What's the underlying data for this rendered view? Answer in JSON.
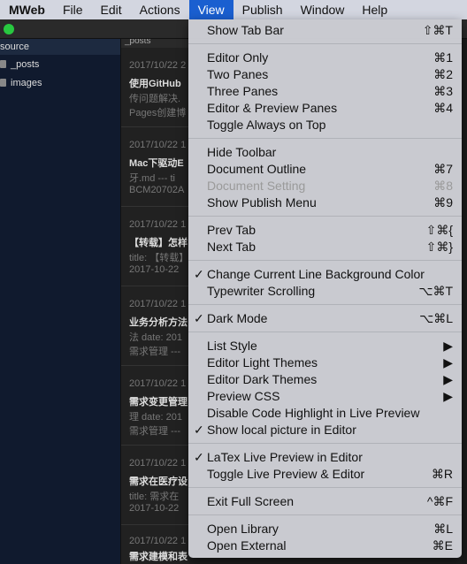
{
  "menubar": {
    "app": "MWeb",
    "items": [
      "File",
      "Edit",
      "Actions",
      "View",
      "Publish",
      "Window",
      "Help"
    ]
  },
  "sidebar": {
    "header": "source",
    "folders": [
      "_posts",
      "images"
    ]
  },
  "list": {
    "header": "_posts",
    "items": [
      {
        "date": "2017/10/22 2",
        "title": "使用GitHub",
        "line2": "传问题解决.",
        "line3": "Pages创建博"
      },
      {
        "date": "2017/10/22 1",
        "title": "Mac下驱动E",
        "line2": "牙.md --- ti",
        "line3": "BCM20702A"
      },
      {
        "date": "2017/10/22 1",
        "title": "【转载】怎样",
        "line2": "title: 【转载】",
        "line3": "2017-10-22"
      },
      {
        "date": "2017/10/22 1",
        "title": "业务分析方法",
        "line2": "法 date: 201",
        "line3": "需求管理 ---"
      },
      {
        "date": "2017/10/22 1",
        "title": "需求变更管理",
        "line2": "理 date: 201",
        "line3": "需求管理 ---"
      },
      {
        "date": "2017/10/22 1",
        "title": "需求在医疗设",
        "line2": "title: 需求在",
        "line3": "2017-10-22"
      },
      {
        "date": "2017/10/22 1",
        "title": "需求建模和表",
        "line2": "",
        "line3": ""
      }
    ]
  },
  "menu": {
    "groups": [
      [
        {
          "label": "Show Tab Bar",
          "shortcut": "⇧⌘T"
        }
      ],
      [
        {
          "label": "Editor Only",
          "shortcut": "⌘1"
        },
        {
          "label": "Two Panes",
          "shortcut": "⌘2"
        },
        {
          "label": "Three Panes",
          "shortcut": "⌘3"
        },
        {
          "label": "Editor & Preview Panes",
          "shortcut": "⌘4"
        },
        {
          "label": "Toggle Always on Top",
          "shortcut": ""
        }
      ],
      [
        {
          "label": "Hide Toolbar",
          "shortcut": ""
        },
        {
          "label": "Document Outline",
          "shortcut": "⌘7"
        },
        {
          "label": "Document Setting",
          "shortcut": "⌘8",
          "disabled": true
        },
        {
          "label": "Show Publish Menu",
          "shortcut": "⌘9"
        }
      ],
      [
        {
          "label": "Prev Tab",
          "shortcut": "⇧⌘{"
        },
        {
          "label": "Next Tab",
          "shortcut": "⇧⌘}"
        }
      ],
      [
        {
          "label": "Change Current Line Background Color",
          "shortcut": "",
          "checked": true
        },
        {
          "label": "Typewriter Scrolling",
          "shortcut": "⌥⌘T"
        }
      ],
      [
        {
          "label": "Dark Mode",
          "shortcut": "⌥⌘L",
          "checked": true
        }
      ],
      [
        {
          "label": "List Style",
          "shortcut": "▶"
        },
        {
          "label": "Editor Light Themes",
          "shortcut": "▶"
        },
        {
          "label": "Editor Dark Themes",
          "shortcut": "▶"
        },
        {
          "label": "Preview CSS",
          "shortcut": "▶"
        },
        {
          "label": "Disable Code Highlight in Live Preview",
          "shortcut": ""
        },
        {
          "label": "Show local picture in Editor",
          "shortcut": "",
          "checked": true
        }
      ],
      [
        {
          "label": "LaTex Live Preview in Editor",
          "shortcut": "",
          "checked": true
        },
        {
          "label": "Toggle Live Preview & Editor",
          "shortcut": "⌘R"
        }
      ],
      [
        {
          "label": "Exit Full Screen",
          "shortcut": "^⌘F"
        }
      ],
      [
        {
          "label": "Open Library",
          "shortcut": "⌘L"
        },
        {
          "label": "Open External",
          "shortcut": "⌘E"
        }
      ]
    ]
  }
}
